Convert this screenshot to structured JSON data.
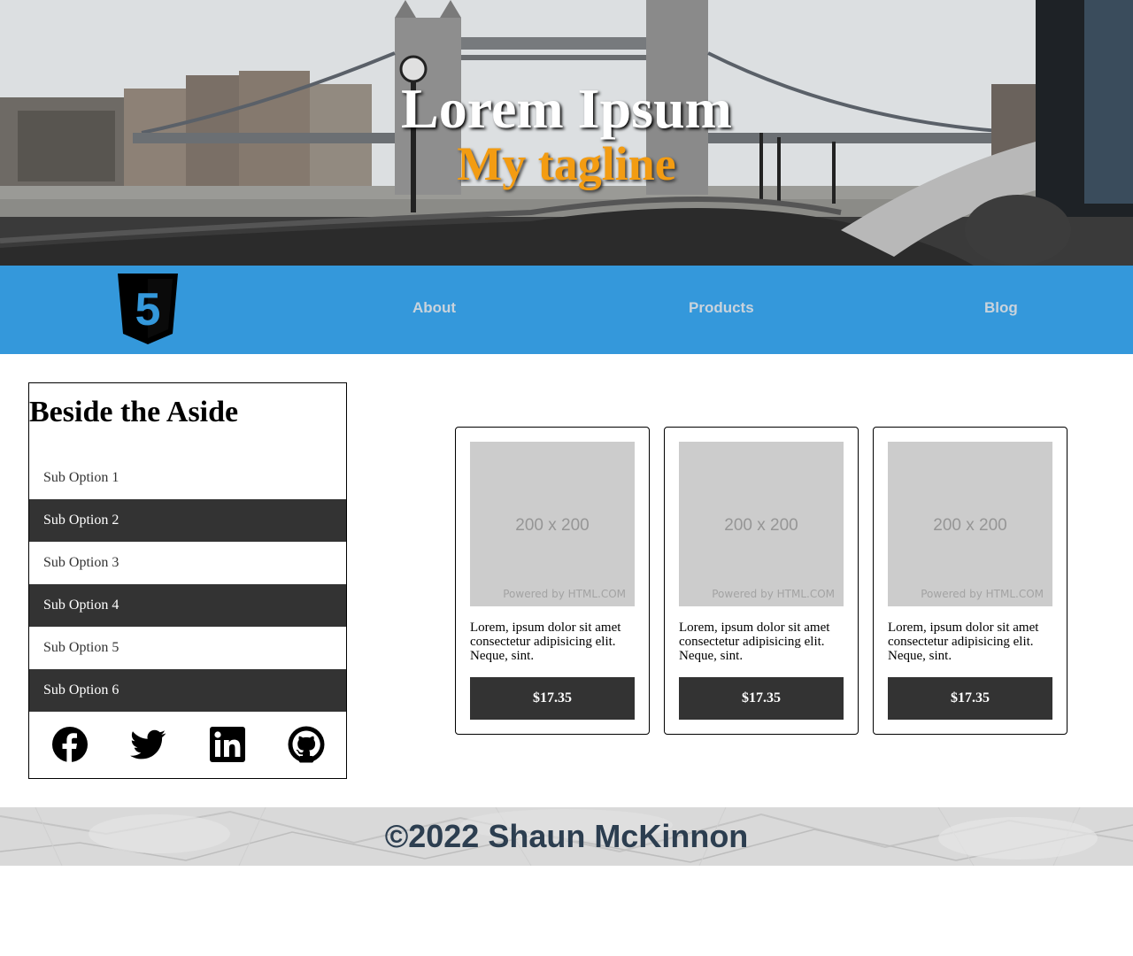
{
  "hero": {
    "title": "Lorem Ipsum",
    "tagline": "My tagline",
    "tagline_color": "#f39c12"
  },
  "nav": {
    "background": "#3498db",
    "logo_icon": "html5-shield-icon",
    "logo_digit": "5",
    "links": [
      {
        "label": "About"
      },
      {
        "label": "Products"
      },
      {
        "label": "Blog"
      }
    ]
  },
  "aside": {
    "title": "Beside the Aside",
    "items": [
      {
        "label": "Sub Option 1"
      },
      {
        "label": "Sub Option 2"
      },
      {
        "label": "Sub Option 3"
      },
      {
        "label": "Sub Option 4"
      },
      {
        "label": "Sub Option 5"
      },
      {
        "label": "Sub Option 6"
      }
    ],
    "social_icons": [
      "facebook-icon",
      "twitter-icon",
      "linkedin-icon",
      "github-icon"
    ]
  },
  "products": [
    {
      "image_dims": "200 x 200",
      "image_credit": "Powered by HTML.COM",
      "description": "Lorem, ipsum dolor sit amet consectetur adipisicing elit. Neque, sint.",
      "price": "$17.35"
    },
    {
      "image_dims": "200 x 200",
      "image_credit": "Powered by HTML.COM",
      "description": "Lorem, ipsum dolor sit amet consectetur adipisicing elit. Neque, sint.",
      "price": "$17.35"
    },
    {
      "image_dims": "200 x 200",
      "image_credit": "Powered by HTML.COM",
      "description": "Lorem, ipsum dolor sit amet consectetur adipisicing elit. Neque, sint.",
      "price": "$17.35"
    }
  ],
  "footer": {
    "text": "©2022 Shaun McKinnon",
    "text_color": "#2c3e50"
  }
}
